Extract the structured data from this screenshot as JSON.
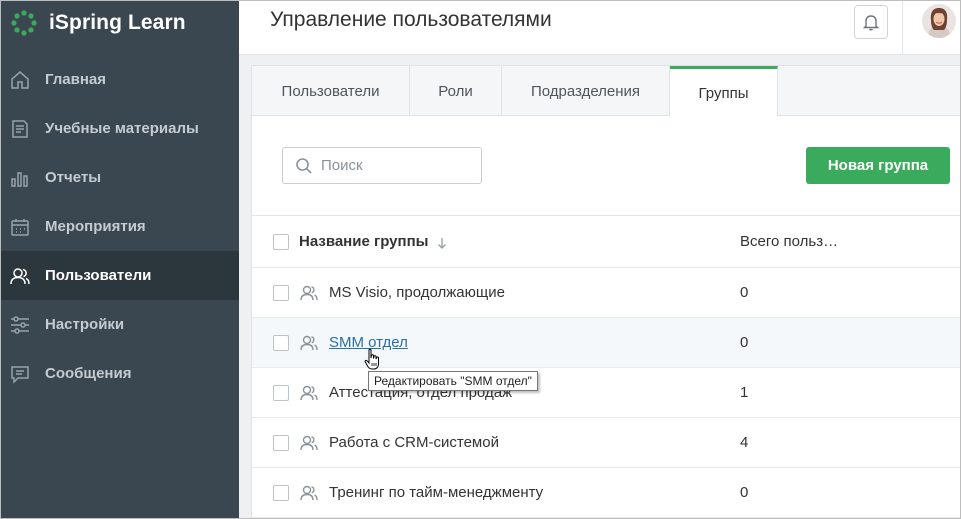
{
  "app": {
    "name": "iSpring Learn"
  },
  "sidebar": {
    "items": [
      {
        "label": "Главная",
        "icon": "home-icon",
        "active": false
      },
      {
        "label": "Учебные материалы",
        "icon": "document-icon",
        "active": false
      },
      {
        "label": "Отчеты",
        "icon": "bar-chart-icon",
        "active": false
      },
      {
        "label": "Мероприятия",
        "icon": "calendar-icon",
        "active": false
      },
      {
        "label": "Пользователи",
        "icon": "users-icon",
        "active": true
      },
      {
        "label": "Настройки",
        "icon": "sliders-icon",
        "active": false
      },
      {
        "label": "Сообщения",
        "icon": "message-icon",
        "active": false
      }
    ]
  },
  "header": {
    "title": "Управление пользователями"
  },
  "tabs": [
    {
      "label": "Пользователи",
      "active": false
    },
    {
      "label": "Роли",
      "active": false
    },
    {
      "label": "Подразделения",
      "active": false
    },
    {
      "label": "Группы",
      "active": true
    }
  ],
  "search": {
    "placeholder": "Поиск",
    "value": ""
  },
  "actions": {
    "new_group_label": "Новая группа"
  },
  "table": {
    "columns": {
      "name": "Название группы",
      "count": "Всего польз…"
    },
    "rows": [
      {
        "name": "MS Visio, продолжающие",
        "count": "0"
      },
      {
        "name": "SMM отдел",
        "count": "0"
      },
      {
        "name": "Аттестация, отдел продаж",
        "count": "1"
      },
      {
        "name": "Работа с CRM-системой",
        "count": "4"
      },
      {
        "name": "Тренинг по тайм-менеджменту",
        "count": "0"
      }
    ]
  },
  "tooltip": {
    "text": "Редактировать \"SMM отдел\""
  },
  "colors": {
    "sidebar": "#3a4750",
    "accent": "#3aaa5c",
    "link": "#2a6fa8"
  }
}
